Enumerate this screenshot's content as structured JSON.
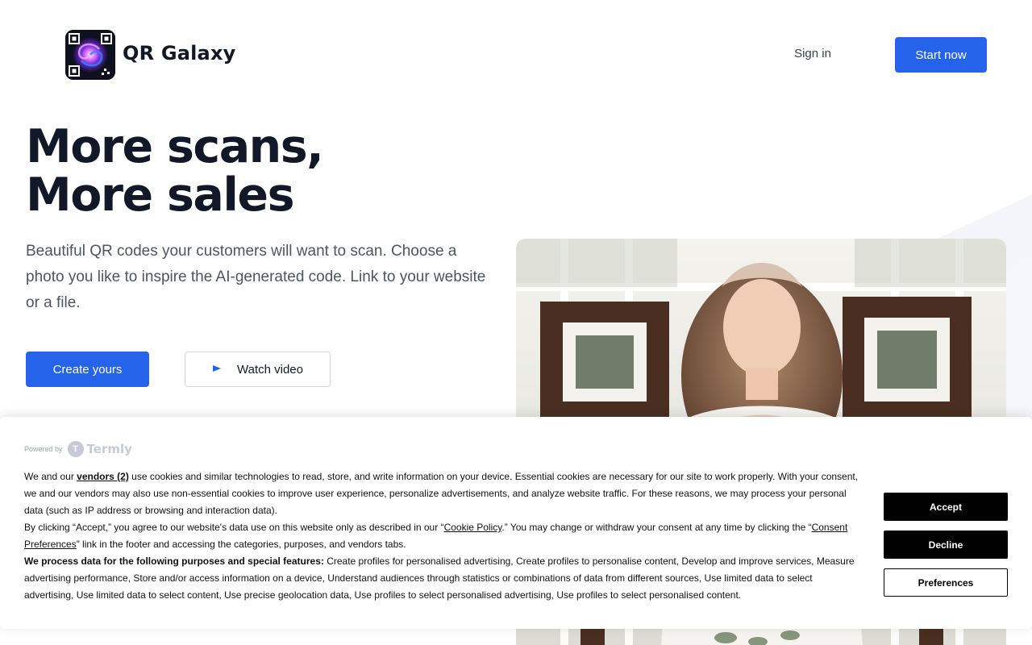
{
  "header": {
    "logo_alt": "QR Galaxy logo",
    "brand_name": "QR Galaxy",
    "signin_label": "Sign in",
    "start_label": "Start now"
  },
  "hero": {
    "title_line1": "More scans,",
    "title_line2": "More sales",
    "subtitle": "Beautiful QR codes your customers will want to scan. Choose a photo you like to inspire the AI-generated code. Link to your website or a file.",
    "create_label": "Create yours",
    "video_label": "Watch video"
  },
  "cookie": {
    "powered_by": "Powered by",
    "brand": "Termly",
    "p1_a": "We and our ",
    "vendors_link": "vendors (2)",
    "p1_b": " use cookies and similar technologies to read, store, and write information on your device. Essential cookies are necessary for our site to work properly. With your consent, we and our vendors may also use non-essential cookies to improve user experience, personalize advertisements, and analyze website traffic. For these reasons, we may process your personal data (such as IP address or browsing and interaction data).",
    "p2_a": "By clicking “Accept,” you agree to our website's data use on this website only as described in our “",
    "cookie_policy_link": "Cookie Policy",
    "p2_b": ".” You may change or withdraw your consent at any time by clicking the “",
    "consent_link": "Consent Preferences",
    "p2_c": "” link in the footer and accessing the categories, purposes, and vendors tabs.",
    "p3_bold": "We process data for the following purposes and special features:",
    "p3_rest": " Create profiles for personalised advertising, Create profiles to personalise content, Develop and improve services, Measure advertising performance, Store and/or access information on a device, Understand audiences through statistics or combinations of data from different sources, Use limited data to select advertising, Use limited data to select content, Use precise geolocation data, Use profiles to select personalised advertising, Use profiles to select personalised content.",
    "accept_label": "Accept",
    "decline_label": "Decline",
    "preferences_label": "Preferences"
  },
  "colors": {
    "accent": "#2563eb",
    "text_dark": "#111827",
    "text_muted": "#4b5563"
  },
  "icons": {
    "logo": "galaxy-qr-icon",
    "play": "play-icon",
    "termly": "termly-logo-icon"
  }
}
